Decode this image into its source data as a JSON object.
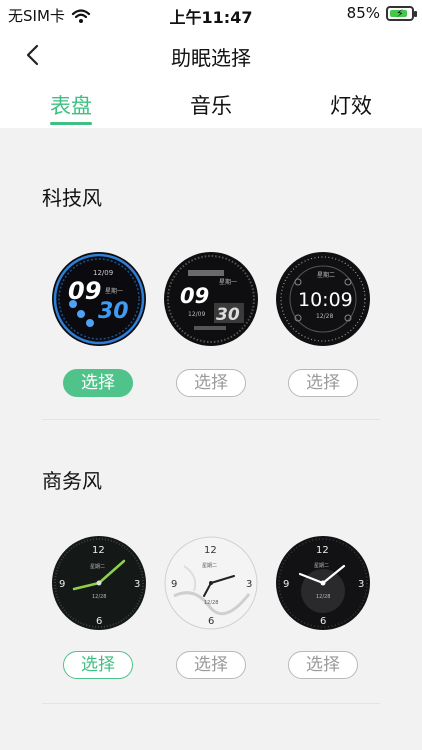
{
  "status_bar": {
    "carrier": "无SIM卡",
    "time": "上午11:47",
    "battery": "85%",
    "battery_level": 0.85
  },
  "header": {
    "title": "助眠选择"
  },
  "tabs": [
    {
      "label": "表盘",
      "active": true
    },
    {
      "label": "音乐",
      "active": false
    },
    {
      "label": "灯效",
      "active": false
    }
  ],
  "sections": [
    {
      "title": "科技风",
      "faces": [
        {
          "time_big": "09",
          "time_small": "30",
          "date": "12/09",
          "weekday": "星期一",
          "button": "选择",
          "selected": true
        },
        {
          "time_big": "09",
          "time_small": "30",
          "date": "12/09",
          "weekday": "星期一",
          "button": "选择",
          "selected": false
        },
        {
          "time": "10:09",
          "date": "12/28",
          "weekday": "星期二",
          "button": "选择",
          "selected": false
        }
      ]
    },
    {
      "title": "商务风",
      "faces": [
        {
          "n12": "12",
          "n3": "3",
          "n6": "6",
          "n9": "9",
          "date": "12/28",
          "weekday": "星期二",
          "button": "选择",
          "selected": true
        },
        {
          "n12": "12",
          "n3": "3",
          "n6": "6",
          "n9": "9",
          "date": "12/28",
          "weekday": "星期二",
          "button": "选择",
          "selected": false
        },
        {
          "n12": "12",
          "n3": "3",
          "n6": "6",
          "n9": "9",
          "date": "12/28",
          "weekday": "星期二",
          "button": "选择",
          "selected": false
        }
      ]
    }
  ],
  "colors": {
    "accent": "#3fbf82",
    "button_fill": "#4fc38a",
    "background": "#f2f2f2"
  }
}
